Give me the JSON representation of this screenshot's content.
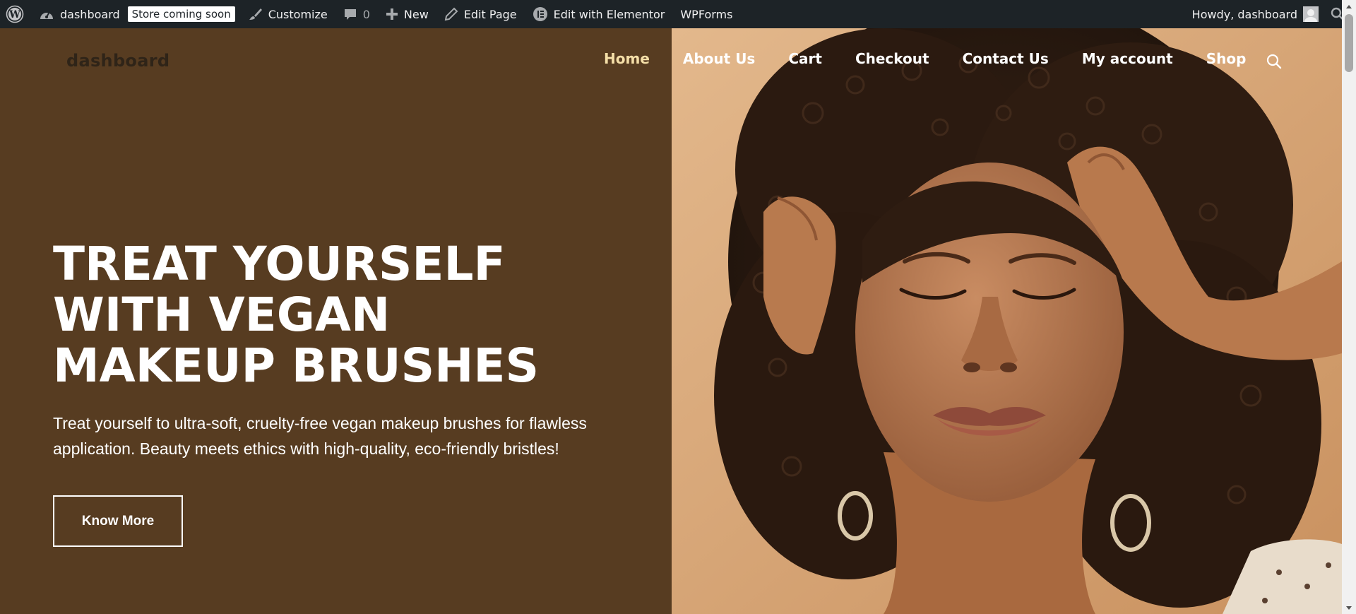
{
  "adminbar": {
    "site_name": "dashboard",
    "store_badge": "Store coming soon",
    "customize": "Customize",
    "comments_count": "0",
    "new": "New",
    "edit_page": "Edit Page",
    "edit_elementor": "Edit with Elementor",
    "wpforms": "WPForms",
    "howdy": "Howdy, dashboard"
  },
  "header": {
    "logo": "dashboard",
    "nav": [
      "Home",
      "About Us",
      "Cart",
      "Checkout",
      "Contact Us",
      "My account",
      "Shop"
    ]
  },
  "hero": {
    "title_lines": [
      "TREAT YOURSELF",
      "WITH VEGAN",
      "MAKEUP BRUSHES"
    ],
    "text": "Treat yourself to ultra-soft, cruelty-free vegan makeup brushes for flawless application. Beauty meets ethics with high-quality, eco-friendly bristles!",
    "button": "Know More"
  },
  "colors": {
    "adminbar_bg": "#1d2327",
    "hero_bg": "#573c21",
    "nav_active": "#f5dfa8",
    "photo_bg": "#d9a77b"
  },
  "icons": {
    "adminbar": [
      "wordpress-logo-icon",
      "dashboard-icon",
      "paintbrush-icon",
      "comment-icon",
      "plus-icon",
      "pencil-icon",
      "elementor-icon",
      "search-icon"
    ],
    "header": [
      "search-icon"
    ]
  }
}
